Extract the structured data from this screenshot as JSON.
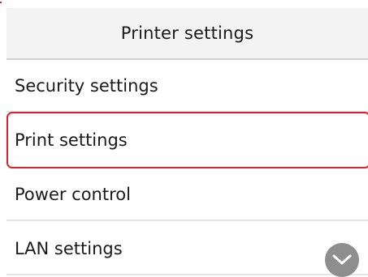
{
  "header": {
    "title": "Printer settings"
  },
  "menu": {
    "items": [
      {
        "label": "Security settings",
        "selected": false
      },
      {
        "label": "Print settings",
        "selected": true
      },
      {
        "label": "Power control",
        "selected": false
      },
      {
        "label": "LAN settings",
        "selected": false
      }
    ]
  },
  "scroll": {
    "icon": "chevron-down-icon"
  },
  "colors": {
    "selection_border": "#e0202a",
    "header_bg": "#f3f3f3",
    "scroll_button": "#8e8e8e"
  }
}
